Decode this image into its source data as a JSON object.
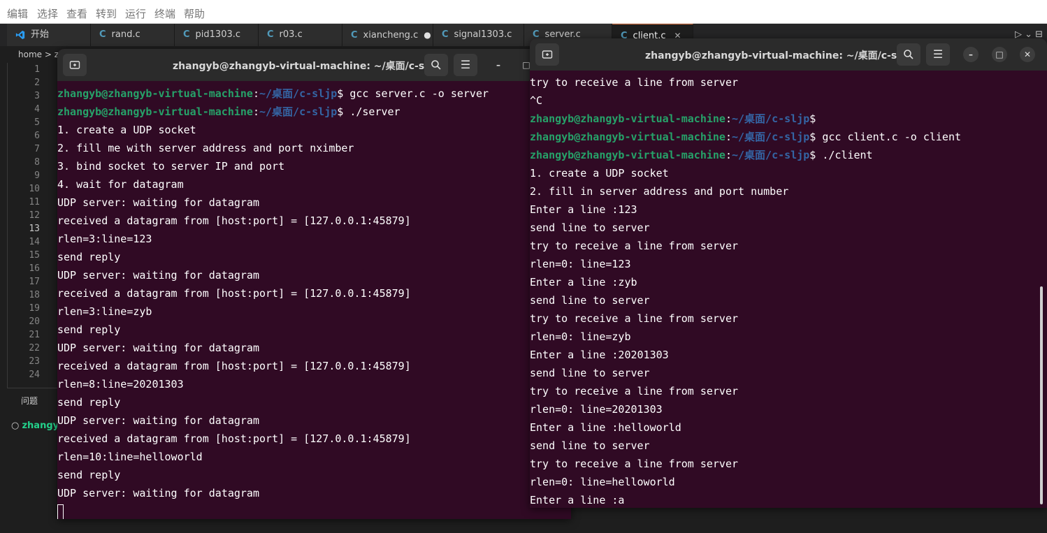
{
  "menubar": {
    "items": [
      "编辑",
      "选择",
      "查看",
      "转到",
      "运行",
      "终端",
      "帮助"
    ]
  },
  "tabs": [
    {
      "label": "开始"
    },
    {
      "label": "rand.c"
    },
    {
      "label": "pid1303.c"
    },
    {
      "label": "r03.c"
    },
    {
      "label": "xiancheng.c",
      "modified_marker": "●"
    },
    {
      "label": "signal1303.c"
    },
    {
      "label": "server.c"
    },
    {
      "label": "client.c",
      "close": "✕"
    }
  ],
  "editor": {
    "breadcrumb": "home > z",
    "line_numbers": [
      "1",
      "2",
      "3",
      "4",
      "5",
      "6",
      "7",
      "8",
      "9",
      "10",
      "11",
      "12",
      "13",
      "14",
      "15",
      "16",
      "17",
      "18",
      "19",
      "20",
      "21",
      "22",
      "23",
      "24"
    ],
    "current_line": "13",
    "panel_tab": "问题",
    "panel_prompt": "zhangyb"
  },
  "terminal_server": {
    "title": "zhangyb@zhangyb-virtual-machine: ~/桌面/c-sljp",
    "lines": [
      {
        "user": "zhangyb@zhangyb-virtual-machine",
        "sep": ":",
        "path": "~/桌面/c-sljp",
        "cmd": "$ gcc server.c -o server"
      },
      {
        "user": "zhangyb@zhangyb-virtual-machine",
        "sep": ":",
        "path": "~/桌面/c-sljp",
        "cmd": "$ ./server"
      },
      {
        "text": "1. create a UDP socket"
      },
      {
        "text": "2. fill me with server address and port nximber"
      },
      {
        "text": "3. bind socket to server IP and port"
      },
      {
        "text": "4. wait for datagram"
      },
      {
        "text": "UDP server: waiting for datagram"
      },
      {
        "text": "received a datagram from [host:port] = [127.0.0.1:45879]"
      },
      {
        "text": "rlen=3:line=123"
      },
      {
        "text": "send reply"
      },
      {
        "text": "UDP server: waiting for datagram"
      },
      {
        "text": "received a datagram from [host:port] = [127.0.0.1:45879]"
      },
      {
        "text": "rlen=3:line=zyb"
      },
      {
        "text": "send reply"
      },
      {
        "text": "UDP server: waiting for datagram"
      },
      {
        "text": "received a datagram from [host:port] = [127.0.0.1:45879]"
      },
      {
        "text": "rlen=8:line=20201303"
      },
      {
        "text": "send reply"
      },
      {
        "text": "UDP server: waiting for datagram"
      },
      {
        "text": "received a datagram from [host:port] = [127.0.0.1:45879]"
      },
      {
        "text": "rlen=10:line=helloworld"
      },
      {
        "text": "send reply"
      },
      {
        "text": "UDP server: waiting for datagram"
      }
    ]
  },
  "terminal_client": {
    "title": "zhangyb@zhangyb-virtual-machine: ~/桌面/c-sljp",
    "lines": [
      {
        "text": "try to receive a line from server"
      },
      {
        "text": "^C"
      },
      {
        "user": "zhangyb@zhangyb-virtual-machine",
        "sep": ":",
        "path": "~/桌面/c-sljp",
        "cmd": "$"
      },
      {
        "user": "zhangyb@zhangyb-virtual-machine",
        "sep": ":",
        "path": "~/桌面/c-sljp",
        "cmd": "$ gcc client.c -o client"
      },
      {
        "user": "zhangyb@zhangyb-virtual-machine",
        "sep": ":",
        "path": "~/桌面/c-sljp",
        "cmd": "$ ./client"
      },
      {
        "text": "1. create a UDP socket"
      },
      {
        "text": "2. fill in server address and port number"
      },
      {
        "text": "Enter a line :123"
      },
      {
        "text": "send line to server"
      },
      {
        "text": "try to receive a line from server"
      },
      {
        "text": "rlen=0: line=123"
      },
      {
        "text": "Enter a line :zyb"
      },
      {
        "text": "send line to server"
      },
      {
        "text": "try to receive a line from server"
      },
      {
        "text": "rlen=0: line=zyb"
      },
      {
        "text": "Enter a line :20201303"
      },
      {
        "text": "send line to server"
      },
      {
        "text": "try to receive a line from server"
      },
      {
        "text": "rlen=0: line=20201303"
      },
      {
        "text": "Enter a line :helloworld"
      },
      {
        "text": "send line to server"
      },
      {
        "text": "try to receive a line from server"
      },
      {
        "text": "rlen=0: line=helloworld"
      },
      {
        "text": "Enter a line :a"
      }
    ]
  },
  "colors": {
    "terminal_bg": "#300a24",
    "prompt_user": "#26a269",
    "prompt_path": "#3465a4",
    "titlebar_bg": "#2b2b2b"
  },
  "icons": [
    "vscode-icon",
    "c-file-icon",
    "new-tab-icon",
    "search-icon",
    "hamburger-menu-icon",
    "minimize-icon",
    "maximize-icon",
    "close-icon"
  ]
}
